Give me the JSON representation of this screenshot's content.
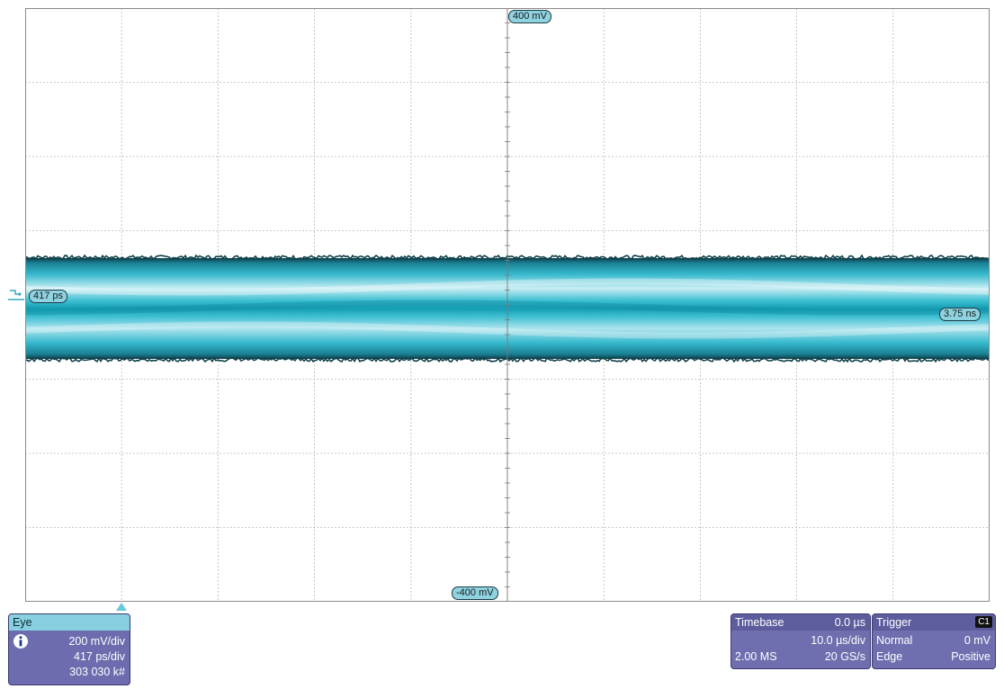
{
  "screen": {
    "labels": {
      "top_offset": "400 mV",
      "bottom_offset": "-400 mV",
      "left_delay": "417 ps",
      "right_delay": "3.75 ns"
    }
  },
  "colors": {
    "trace": "#35b9cc",
    "trace_dark": "#0e3f49",
    "grid": "#b9b9b9",
    "panel": "#6f6fb0",
    "panel_header_cyan": "#88cfe0"
  },
  "icons": {
    "reference_arrow": "ground-reference-arrow-icon",
    "trigger_marker": "triangle-up-icon",
    "info": "info-icon"
  },
  "eye_panel": {
    "title": "Eye",
    "vdiv": "200 mV/div",
    "tdiv": "417 ps/div",
    "count": "303 030 k#"
  },
  "timebase_panel": {
    "title": "Timebase",
    "delay": "0.0 µs",
    "tdiv": "10.0 µs/div",
    "samples": "2.00 MS",
    "rate": "20 GS/s"
  },
  "trigger_panel": {
    "title": "Trigger",
    "channel": "C1",
    "mode": "Normal",
    "level": "0 mV",
    "type": "Edge",
    "slope": "Positive"
  }
}
